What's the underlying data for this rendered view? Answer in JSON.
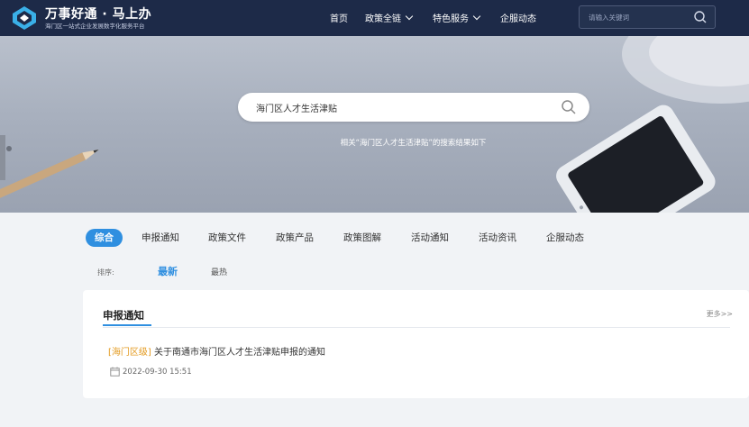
{
  "header": {
    "brand_title": "万事好通 · 马上办",
    "brand_subtitle": "海门区一站式企业发展数字化服务平台",
    "nav": [
      {
        "label": "首页"
      },
      {
        "label": "政策全链"
      },
      {
        "label": "特色服务"
      },
      {
        "label": "企服动态"
      }
    ],
    "search_placeholder": "请输入关键词"
  },
  "banner": {
    "search_value": "海门区人才生活津贴",
    "result_text": "相关“海门区人才生活津贴”的搜索结果如下"
  },
  "tabs": [
    {
      "label": "综合",
      "active": true
    },
    {
      "label": "申报通知"
    },
    {
      "label": "政策文件"
    },
    {
      "label": "政策产品"
    },
    {
      "label": "政策图解"
    },
    {
      "label": "活动通知"
    },
    {
      "label": "活动资讯"
    },
    {
      "label": "企服动态"
    }
  ],
  "sort": {
    "label": "排序:",
    "options": [
      {
        "label": "最新",
        "active": true
      },
      {
        "label": "最热"
      }
    ]
  },
  "card": {
    "title": "申报通知",
    "more": "更多>>",
    "items": [
      {
        "tag": "[海门区级]",
        "title": "关于南通市海门区人才生活津贴申报的通知",
        "date": "2022-09-30 15:51"
      }
    ]
  },
  "colors": {
    "header_bg": "#1d2a48",
    "accent": "#2f8fe0",
    "tag": "#e39a1f"
  }
}
